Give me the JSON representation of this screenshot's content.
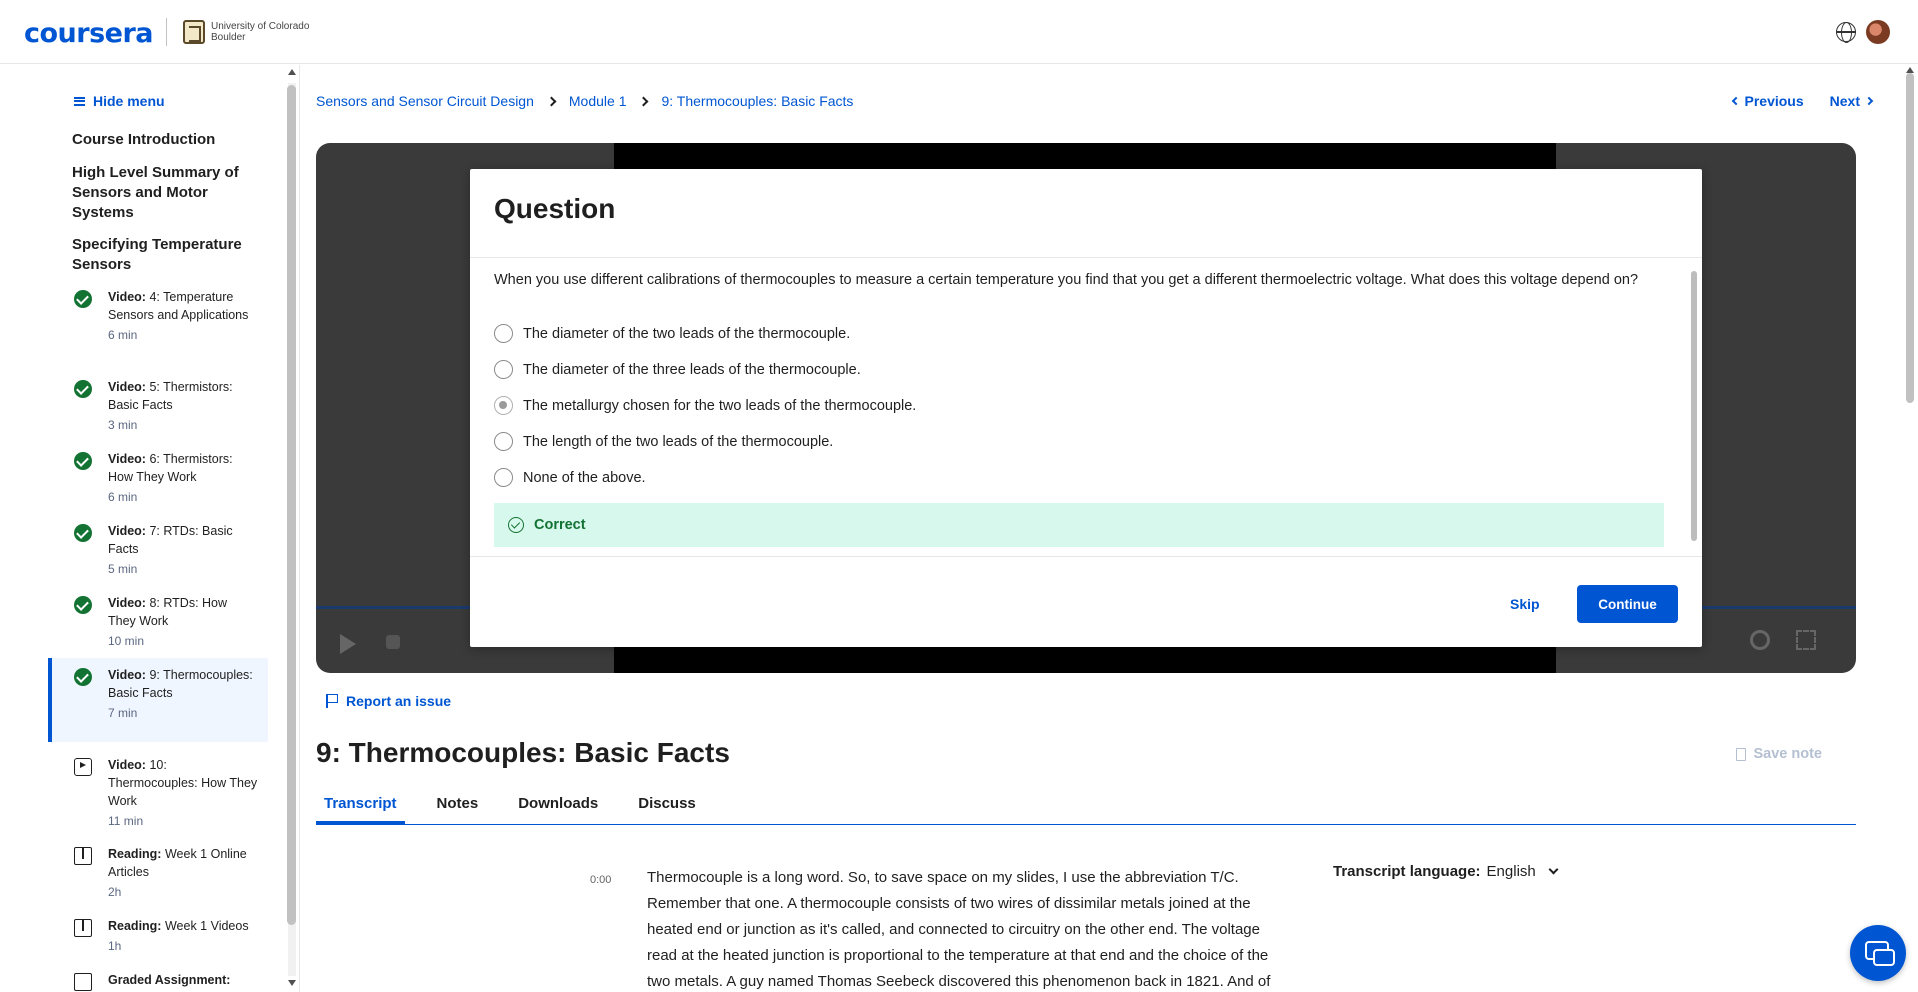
{
  "header": {
    "logo": "coursera",
    "university": "University of Colorado Boulder"
  },
  "sidebar": {
    "hide_menu": "Hide menu",
    "sections": [
      "Course Introduction",
      "High Level Summary of Sensors and Motor Systems",
      "Specifying Temperature Sensors"
    ],
    "items": [
      {
        "type": "Video:",
        "title": "4: Temperature Sensors and Applications",
        "duration": "6 min",
        "status": "completed"
      },
      {
        "type": "Video:",
        "title": "5: Thermistors: Basic Facts",
        "duration": "3 min",
        "status": "completed"
      },
      {
        "type": "Video:",
        "title": "6: Thermistors: How They Work",
        "duration": "6 min",
        "status": "completed"
      },
      {
        "type": "Video:",
        "title": "7: RTDs: Basic Facts",
        "duration": "5 min",
        "status": "completed"
      },
      {
        "type": "Video:",
        "title": "8: RTDs: How They Work",
        "duration": "10 min",
        "status": "completed"
      },
      {
        "type": "Video:",
        "title": "9: Thermocouples: Basic Facts",
        "duration": "7 min",
        "status": "completed"
      },
      {
        "type": "Video:",
        "title": "10: Thermocouples: How They Work",
        "duration": "11 min",
        "status": "video"
      },
      {
        "type": "Reading:",
        "title": "Week 1 Online Articles",
        "duration": "2h",
        "status": "reading"
      },
      {
        "type": "Reading:",
        "title": "Week 1 Videos",
        "duration": "1h",
        "status": "reading"
      },
      {
        "type": "Graded Assignment:",
        "title": "",
        "duration": "",
        "status": "assignment"
      }
    ]
  },
  "breadcrumb": [
    "Sensors and Sensor Circuit Design",
    "Module 1",
    "9: Thermocouples: Basic Facts"
  ],
  "nav": {
    "previous": "Previous",
    "next": "Next"
  },
  "quiz": {
    "heading": "Question",
    "question": "When you use different calibrations of thermocouples to measure a certain temperature you find that you get a different thermoelectric voltage. What does this voltage depend on?",
    "options": [
      "The diameter of the two leads of the thermocouple.",
      "The diameter of the three leads of the thermocouple.",
      "The metallurgy chosen for the two leads of the thermocouple.",
      "The length of the two leads of the thermocouple.",
      "None of the above."
    ],
    "selected_index": 2,
    "feedback": "Correct",
    "skip": "Skip",
    "continue": "Continue"
  },
  "report_issue": "Report an issue",
  "lesson_title": "9: Thermocouples: Basic Facts",
  "save_note": "Save note",
  "tabs": [
    "Transcript",
    "Notes",
    "Downloads",
    "Discuss"
  ],
  "transcript": {
    "timestamp": "0:00",
    "text": "Thermocouple is a long word. So, to save space on my slides, I use the abbreviation T/C. Remember that one. A thermocouple consists of two wires of dissimilar metals joined at the heated end or junction as it's called, and connected to circuitry on the other end. The voltage read at the heated junction is proportional to the temperature at that end and the choice of the two metals. A guy named Thomas Seebeck discovered this phenomenon back in 1821. And of",
    "language_label": "Transcript language:",
    "language": "English"
  },
  "colors": {
    "accent": "#0056d2",
    "success": "#137333",
    "success_bg": "#d7f8ec"
  }
}
